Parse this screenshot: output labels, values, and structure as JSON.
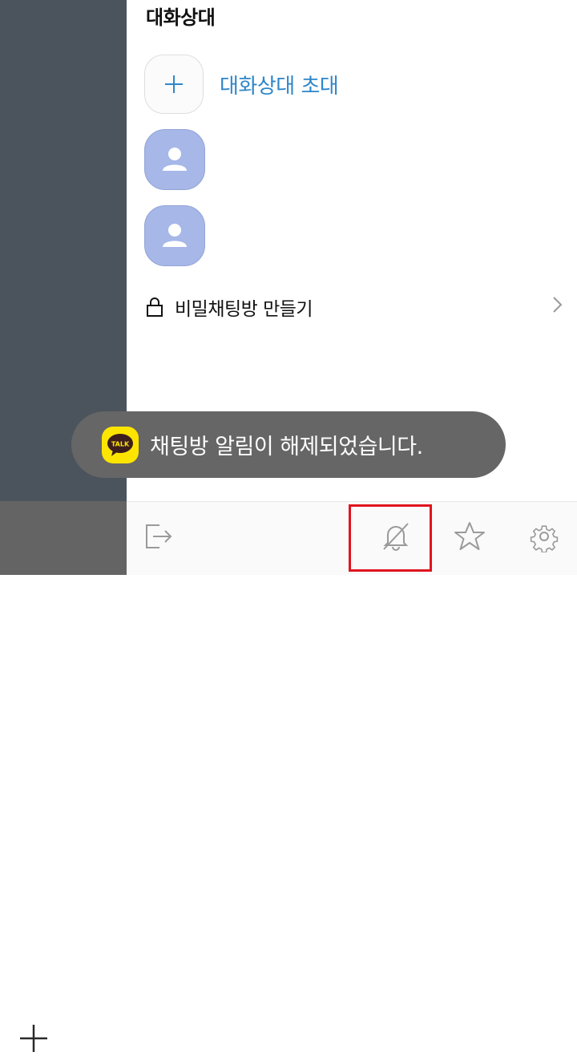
{
  "drawer": {
    "section_title": "대화상대",
    "invite_label": "대화상대 초대",
    "members": [
      {
        "icon": "person-icon"
      },
      {
        "icon": "person-icon"
      }
    ],
    "secret_chat_label": "비밀채팅방 만들기"
  },
  "toast": {
    "badge_text": "TALK",
    "message": "채팅방 알림이 해제되었습니다."
  },
  "bottom_bar": {
    "buttons": [
      "exit-icon",
      "bell-off-icon",
      "star-icon",
      "gear-icon"
    ],
    "highlight_color": "#e0141e"
  },
  "colors": {
    "accent": "#2e86c9",
    "avatar": "#a6b7e8",
    "kakao_yellow": "#fee500"
  }
}
